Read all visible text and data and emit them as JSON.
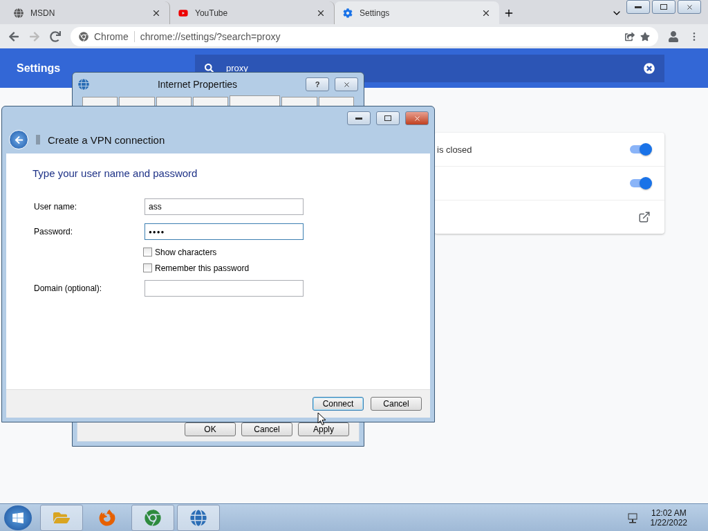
{
  "browser": {
    "tabs": [
      {
        "title": "MSDN",
        "selected": false
      },
      {
        "title": "YouTube",
        "selected": false
      },
      {
        "title": "Settings",
        "selected": true
      }
    ],
    "omnibox": {
      "site": "Chrome",
      "url": "chrome://settings/?search=proxy"
    }
  },
  "settings": {
    "title": "Settings",
    "search": {
      "value": "proxy"
    },
    "rows": [
      {
        "kind": "toggle",
        "label": "is closed",
        "on": true
      },
      {
        "kind": "toggle",
        "on": true
      },
      {
        "kind": "link"
      }
    ]
  },
  "internet_properties": {
    "title": "Internet Properties",
    "help_button": "?",
    "buttons": [
      "OK",
      "Cancel",
      "Apply"
    ]
  },
  "vpn_dialog": {
    "title": "Create a VPN connection",
    "heading": "Type your user name and password",
    "fields": [
      {
        "kind": "text",
        "label": "User name:",
        "value": "ass",
        "focused": false
      },
      {
        "kind": "password",
        "label": "Password:",
        "value": "●●●●",
        "focused": true
      },
      {
        "kind": "checkbox",
        "label": "Show characters",
        "checked": false
      },
      {
        "kind": "checkbox",
        "label": "Remember this password",
        "checked": false
      },
      {
        "kind": "text",
        "label": "Domain (optional):",
        "focused": false
      }
    ],
    "buttons": [
      {
        "label": "Connect",
        "default": true
      },
      {
        "label": "Cancel",
        "default": false
      }
    ]
  },
  "taskbar": {
    "time": "12:02 AM",
    "date": "1/22/2022"
  }
}
